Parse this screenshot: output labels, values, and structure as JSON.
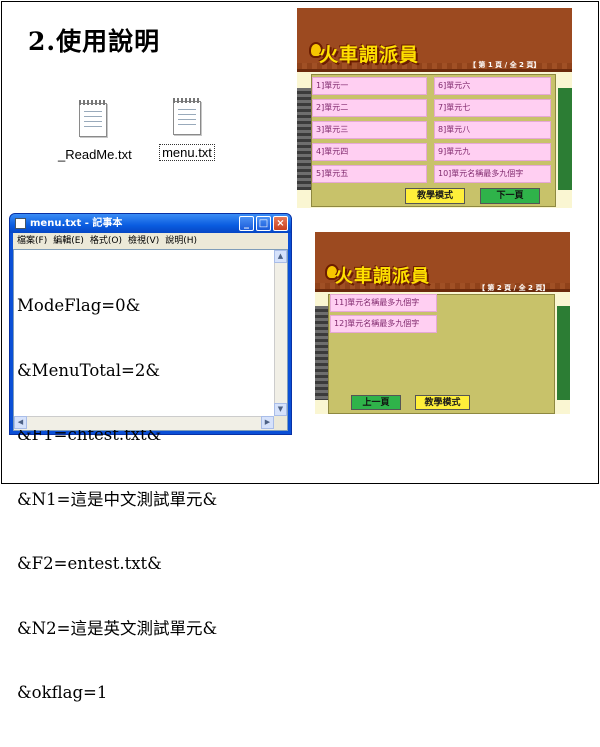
{
  "heading": "2.使用說明",
  "files": [
    {
      "name": "_ReadMe.txt",
      "selected": false
    },
    {
      "name": "menu.txt",
      "selected": true
    }
  ],
  "notepad": {
    "title": "menu.txt - 記事本",
    "menu": [
      "檔案(F)",
      "編輯(E)",
      "格式(O)",
      "檢視(V)",
      "說明(H)"
    ],
    "lines": [
      "ModeFlag=0&",
      "&MenuTotal=2&",
      "&F1=chtest.txt&",
      "&N1=這是中文測試單元&",
      "&F2=entest.txt&",
      "&N2=這是英文測試單元&",
      "&okflag=1"
    ]
  },
  "screen1": {
    "title": "火車調派員",
    "page": "【 第 1 頁 / 全 2 頁】",
    "left_units": [
      "1]單元一",
      "2]單元二",
      "3]單元三",
      "4]單元四",
      "5]單元五"
    ],
    "right_units": [
      "6]單元六",
      "7]單元七",
      "8]單元八",
      "9]單元九",
      "10]單元名稱最多九個字"
    ],
    "btn_mode": "教學模式",
    "btn_next": "下一頁"
  },
  "screen2": {
    "title": "火車調派員",
    "page": "【 第 2 頁 / 全 2 頁】",
    "units": [
      "11]單元名稱最多九個字",
      "12]單元名稱最多九個字"
    ],
    "btn_prev": "上一頁",
    "btn_mode": "教學模式"
  },
  "colors": {
    "roof": "#9c4a20",
    "title_yellow": "#ffe100",
    "unit_pink": "#ffcff2",
    "panel": "#c8c26a",
    "button_green": "#2fb34a",
    "button_yellow": "#ffef3a"
  },
  "icons": [
    "text-file-icon",
    "notepad-icon",
    "minimize-icon",
    "maximize-icon",
    "close-icon",
    "fire-icon"
  ]
}
